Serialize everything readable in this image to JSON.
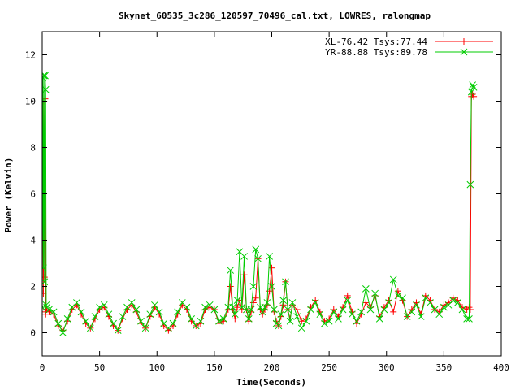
{
  "chart_data": {
    "type": "line",
    "title": "Skynet_60535_3c286_120597_70496_cal.txt, LOWRES, ralongmap",
    "xlabel": "Time(Seconds)",
    "ylabel": "Power (Kelvin)",
    "xlim": [
      0,
      400
    ],
    "ylim": [
      -1,
      13
    ],
    "x_ticks": [
      0,
      50,
      100,
      150,
      200,
      250,
      300,
      350,
      400
    ],
    "y_ticks": [
      0,
      2,
      4,
      6,
      8,
      10,
      12
    ],
    "grid": false,
    "legend_position": "top-right",
    "series": [
      {
        "name": "XL-76.42 Tsys:77.44",
        "color": "#ff0000",
        "marker": "plus",
        "x": [
          0,
          0.5,
          1,
          1.5,
          2,
          2.5,
          3,
          3.5,
          4,
          6,
          10,
          14,
          18,
          22,
          26,
          30,
          34,
          38,
          42,
          46,
          50,
          54,
          58,
          62,
          66,
          70,
          74,
          78,
          82,
          86,
          90,
          94,
          98,
          102,
          106,
          110,
          114,
          118,
          122,
          126,
          130,
          134,
          138,
          142,
          146,
          150,
          154,
          158,
          162,
          164,
          166,
          168,
          170,
          172,
          174,
          176,
          178,
          180,
          182,
          184,
          186,
          188,
          190,
          192,
          194,
          196,
          198,
          200,
          202,
          204,
          206,
          208,
          210,
          212,
          214,
          216,
          218,
          222,
          226,
          230,
          234,
          238,
          242,
          246,
          250,
          254,
          258,
          262,
          266,
          270,
          274,
          278,
          282,
          286,
          290,
          294,
          298,
          302,
          306,
          310,
          314,
          318,
          322,
          326,
          330,
          334,
          338,
          342,
          346,
          350,
          354,
          358,
          362,
          366,
          370,
          372,
          373,
          374,
          375,
          376
        ],
        "values": [
          0.9,
          10.0,
          1.7,
          10.0,
          2.4,
          10.1,
          0.8,
          1.0,
          1.0,
          0.9,
          0.8,
          0.3,
          0.1,
          0.5,
          1.0,
          1.2,
          0.8,
          0.4,
          0.2,
          0.6,
          1.0,
          1.1,
          0.7,
          0.3,
          0.1,
          0.6,
          1.0,
          1.2,
          0.9,
          0.4,
          0.2,
          0.7,
          1.1,
          0.8,
          0.3,
          0.1,
          0.3,
          0.8,
          1.2,
          1.0,
          0.5,
          0.3,
          0.4,
          1.0,
          1.1,
          1.0,
          0.4,
          0.5,
          1.0,
          2.0,
          1.0,
          0.6,
          1.1,
          1.4,
          1.0,
          2.5,
          1.0,
          0.5,
          0.9,
          1.3,
          1.5,
          3.2,
          1.0,
          0.8,
          1.0,
          1.2,
          1.8,
          2.8,
          0.9,
          0.5,
          0.3,
          0.7,
          1.2,
          2.2,
          1.0,
          0.6,
          1.2,
          1.0,
          0.5,
          0.6,
          1.1,
          1.4,
          0.9,
          0.5,
          0.6,
          1.0,
          0.7,
          1.1,
          1.6,
          0.9,
          0.4,
          0.8,
          1.3,
          1.1,
          1.6,
          0.7,
          1.1,
          1.4,
          0.9,
          1.8,
          1.4,
          0.7,
          1.0,
          1.3,
          0.8,
          1.6,
          1.4,
          1.0,
          0.9,
          1.2,
          1.3,
          1.5,
          1.4,
          1.1,
          1.0,
          1.1,
          1.0,
          10.2,
          10.3,
          10.2
        ]
      },
      {
        "name": "YR-88.88 Tsys:89.78",
        "color": "#00cc00",
        "marker": "x",
        "x": [
          0,
          0.5,
          1,
          1.5,
          2,
          2.5,
          3,
          3.5,
          4,
          6,
          10,
          14,
          18,
          22,
          26,
          30,
          34,
          38,
          42,
          46,
          50,
          54,
          58,
          62,
          66,
          70,
          74,
          78,
          82,
          86,
          90,
          94,
          98,
          102,
          106,
          110,
          114,
          118,
          122,
          126,
          130,
          134,
          138,
          142,
          146,
          150,
          154,
          158,
          162,
          164,
          166,
          168,
          170,
          172,
          174,
          176,
          178,
          180,
          182,
          184,
          186,
          188,
          190,
          192,
          194,
          196,
          198,
          200,
          202,
          204,
          206,
          208,
          210,
          212,
          214,
          216,
          218,
          222,
          226,
          230,
          234,
          238,
          242,
          246,
          250,
          254,
          258,
          262,
          266,
          270,
          274,
          278,
          282,
          286,
          290,
          294,
          298,
          302,
          306,
          310,
          314,
          318,
          322,
          326,
          330,
          334,
          338,
          342,
          346,
          350,
          354,
          358,
          362,
          366,
          370,
          372,
          373,
          374,
          375,
          376
        ],
        "values": [
          1.1,
          11.0,
          2.8,
          11.1,
          2.2,
          11.1,
          10.5,
          1.2,
          1.1,
          1.0,
          0.9,
          0.4,
          0.0,
          0.6,
          1.1,
          1.3,
          0.9,
          0.5,
          0.2,
          0.7,
          1.1,
          1.2,
          0.8,
          0.4,
          0.1,
          0.7,
          1.1,
          1.3,
          1.0,
          0.5,
          0.2,
          0.8,
          1.2,
          0.9,
          0.4,
          0.2,
          0.4,
          0.9,
          1.3,
          1.1,
          0.6,
          0.3,
          0.5,
          1.1,
          1.2,
          1.0,
          0.5,
          0.6,
          1.1,
          2.7,
          1.1,
          0.8,
          1.4,
          3.5,
          1.1,
          3.3,
          1.0,
          0.6,
          1.0,
          2.0,
          3.6,
          3.2,
          1.1,
          0.9,
          1.1,
          1.3,
          3.3,
          2.0,
          1.0,
          0.4,
          0.3,
          0.8,
          1.4,
          2.2,
          1.0,
          0.5,
          1.3,
          0.7,
          0.2,
          0.5,
          1.0,
          1.3,
          0.8,
          0.4,
          0.5,
          0.9,
          0.6,
          1.0,
          1.4,
          0.8,
          0.5,
          0.9,
          1.9,
          1.0,
          1.7,
          0.6,
          1.0,
          1.3,
          2.3,
          1.6,
          1.5,
          0.7,
          0.9,
          1.2,
          0.7,
          1.5,
          1.3,
          1.0,
          0.8,
          1.1,
          1.2,
          1.4,
          1.3,
          1.0,
          0.6,
          0.6,
          6.4,
          10.4,
          10.7,
          10.6
        ]
      }
    ]
  }
}
